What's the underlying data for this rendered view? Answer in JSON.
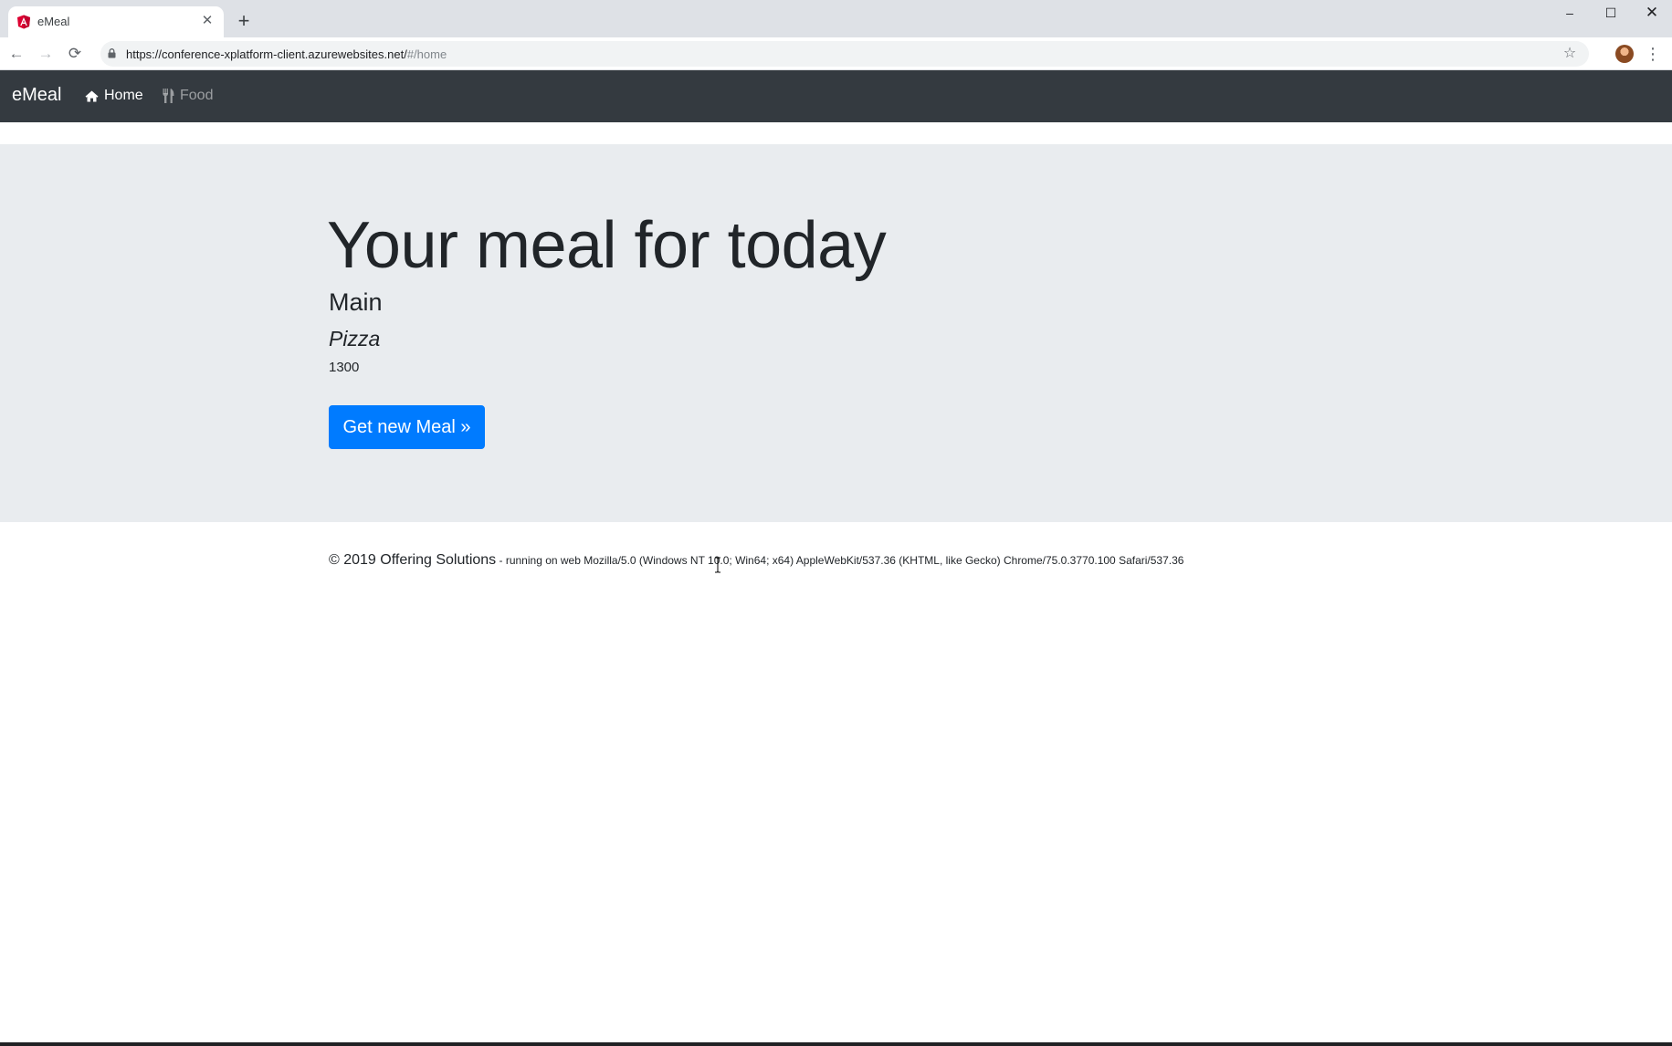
{
  "browser": {
    "tab": {
      "title": "eMeal",
      "favicon": "angular-icon"
    },
    "new_tab": "+",
    "window_controls": {
      "minimize": "–",
      "maximize": "☐",
      "close": "✕"
    },
    "nav": {
      "back": "←",
      "forward": "→",
      "reload": "⟳"
    },
    "address": {
      "host": "https://conference-xplatform-client.azurewebsites.net/",
      "path": "#/home"
    },
    "star": "☆",
    "menu": "⋮"
  },
  "navbar": {
    "brand": "eMeal",
    "links": [
      {
        "label": "Home",
        "icon": "home-icon",
        "active": true
      },
      {
        "label": "Food",
        "icon": "cutlery-icon",
        "active": false
      }
    ]
  },
  "jumbotron": {
    "title": "Your meal for today",
    "course": "Main",
    "meal_name": "Pizza",
    "calories": "1300",
    "button_label": "Get new Meal »"
  },
  "footer": {
    "copyright": "© 2019 Offering Solutions",
    "environment": " - running on web Mozilla/5.0 (Windows NT 10.0; Win64; x64) AppleWebKit/537.36 (KHTML, like Gecko) Chrome/75.0.3770.100 Safari/537.36"
  },
  "colors": {
    "navbar_bg": "#343a40",
    "jumbotron_bg": "#e9ecef",
    "primary": "#007bff"
  }
}
